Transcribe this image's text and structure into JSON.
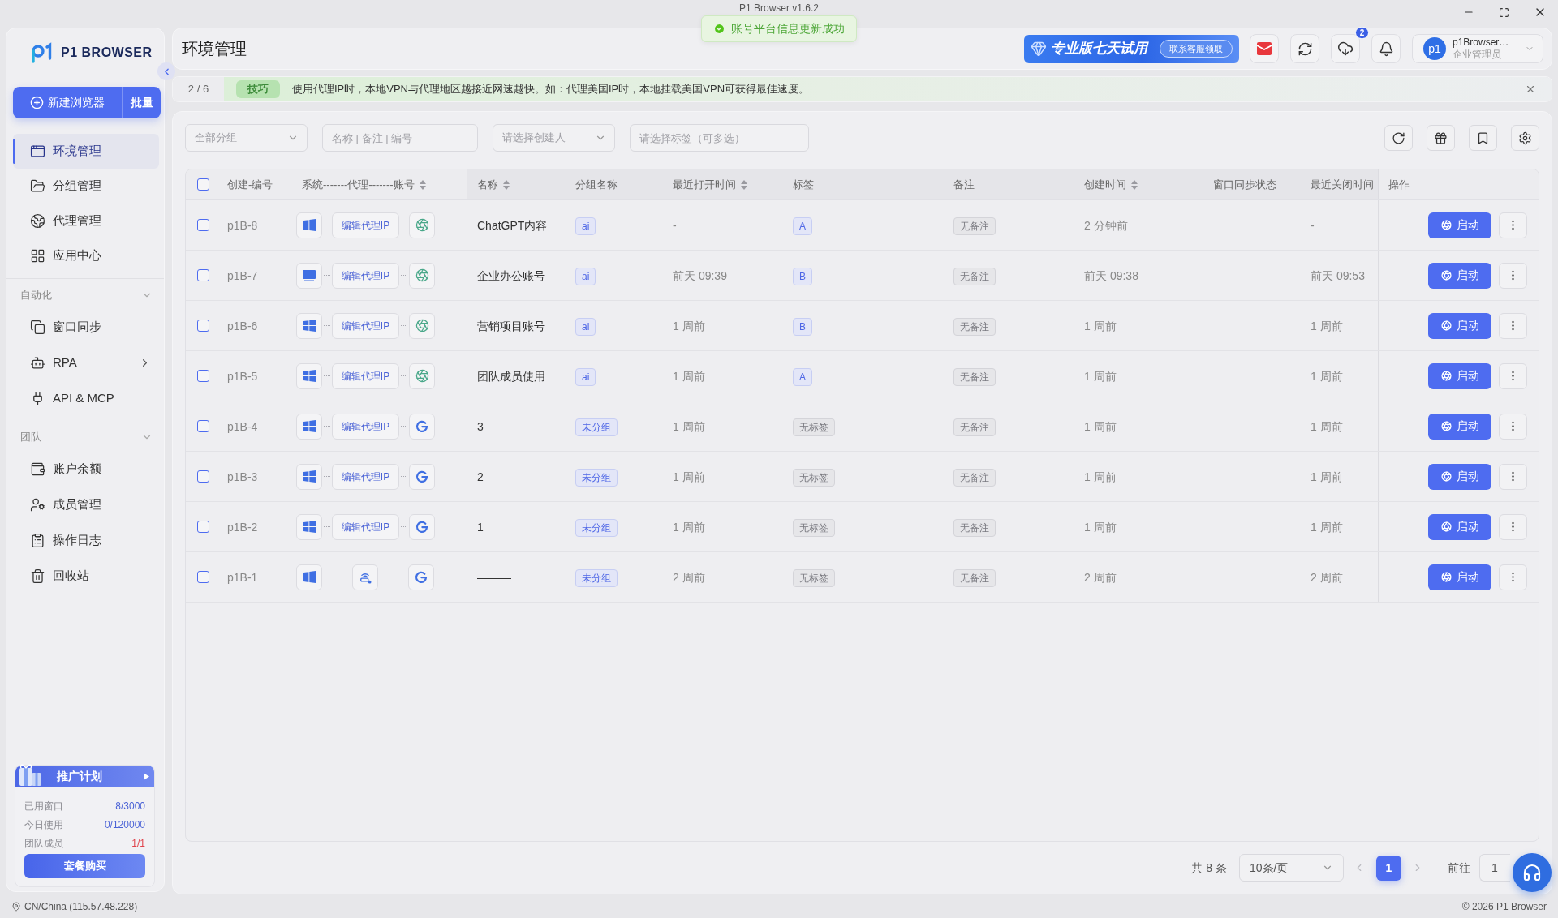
{
  "window": {
    "title": "P1 Browser v1.6.2"
  },
  "toast": {
    "text": "账号平台信息更新成功"
  },
  "sidebar": {
    "brand": "P1 BROWSER",
    "new_button": "新建浏览器",
    "batch_button": "批量",
    "nav": [
      {
        "label": "环境管理",
        "selected": true
      },
      {
        "label": "分组管理",
        "selected": false
      },
      {
        "label": "代理管理",
        "selected": false
      },
      {
        "label": "应用中心",
        "selected": false
      }
    ],
    "sections": [
      {
        "title": "自动化",
        "expanded": true,
        "items": [
          {
            "label": "窗口同步",
            "selected": false
          },
          {
            "label": "RPA",
            "selected": false,
            "expanded": false
          },
          {
            "label": "API & MCP",
            "selected": false
          }
        ]
      },
      {
        "title": "团队",
        "expanded": true,
        "items": [
          {
            "label": "账户余额",
            "selected": false
          },
          {
            "label": "成员管理",
            "selected": false
          },
          {
            "label": "操作日志",
            "selected": false
          },
          {
            "label": "回收站",
            "selected": false
          }
        ]
      }
    ],
    "promo": {
      "title": "推广计划",
      "stats": [
        {
          "label": "已用窗口",
          "value": "8/3000",
          "color": "#4a62d6"
        },
        {
          "label": "今日使用",
          "value": "0/120000",
          "color": "#4a62d6"
        },
        {
          "label": "团队成员",
          "value": "1/1",
          "color": "#e0434b"
        }
      ],
      "button": "套餐购买"
    }
  },
  "header": {
    "title": "环境管理",
    "trial": {
      "title": "专业版七天试用",
      "action": "联系客服领取"
    },
    "download_badge": "2",
    "user": {
      "avatar": "p1",
      "name": "p1Browser…",
      "role": "企业管理员"
    }
  },
  "tip": {
    "counter": "2 / 6",
    "badge": "技巧",
    "text": "使用代理IP时，本地VPN与代理地区越接近网速越快。如：代理美国IP时，本地挂载美国VPN可获得最佳速度。"
  },
  "filters": [
    {
      "kind": "select",
      "placeholder": "全部分组"
    },
    {
      "kind": "input",
      "placeholder": "名称 | 备注 | 编号"
    },
    {
      "kind": "select",
      "placeholder": "请选择创建人"
    },
    {
      "kind": "input",
      "placeholder": "请选择标签（可多选）"
    }
  ],
  "table": {
    "select_all": {
      "checked": false
    },
    "columns": [
      {
        "label": "创建-编号",
        "sortable": false
      },
      {
        "label": "系统-------代理-------账号",
        "sortable": true
      },
      {
        "label": "名称",
        "sortable": true
      },
      {
        "label": "分组名称",
        "sortable": false
      },
      {
        "label": "最近打开时间",
        "sortable": true
      },
      {
        "label": "标签",
        "sortable": false
      },
      {
        "label": "备注",
        "sortable": false
      },
      {
        "label": "创建时间",
        "sortable": true
      },
      {
        "label": "窗口同步状态",
        "sortable": false
      },
      {
        "label": "最近关闭时间",
        "sortable": false
      },
      {
        "label": "操作",
        "sortable": false
      }
    ],
    "rows": [
      {
        "checked": false,
        "code": "p1B-8",
        "system": {
          "kind": "windows"
        },
        "proxy": {
          "kind": "button",
          "label": "编辑代理IP"
        },
        "account": {
          "kind": "openai"
        },
        "name": "ChatGPT内容",
        "group": "ai",
        "last_open": "-",
        "tag": {
          "kind": "tag",
          "label": "A"
        },
        "note": "无备注",
        "created": "2 分钟前",
        "closed": "-",
        "action": "启动"
      },
      {
        "checked": false,
        "code": "p1B-7",
        "system": {
          "kind": "monitor"
        },
        "proxy": {
          "kind": "button",
          "label": "编辑代理IP"
        },
        "account": {
          "kind": "openai"
        },
        "name": "企业办公账号",
        "group": "ai",
        "last_open": "前天 09:39",
        "tag": {
          "kind": "tag",
          "label": "B"
        },
        "note": "无备注",
        "created": "前天 09:38",
        "closed": "前天 09:53",
        "action": "启动"
      },
      {
        "checked": false,
        "code": "p1B-6",
        "system": {
          "kind": "windows"
        },
        "proxy": {
          "kind": "button",
          "label": "编辑代理IP"
        },
        "account": {
          "kind": "openai"
        },
        "name": "营销项目账号",
        "group": "ai",
        "last_open": "1 周前",
        "tag": {
          "kind": "tag",
          "label": "B"
        },
        "note": "无备注",
        "created": "1 周前",
        "closed": "1 周前",
        "action": "启动"
      },
      {
        "checked": false,
        "code": "p1B-5",
        "system": {
          "kind": "windows"
        },
        "proxy": {
          "kind": "button",
          "label": "编辑代理IP"
        },
        "account": {
          "kind": "openai"
        },
        "name": "团队成员使用",
        "group": "ai",
        "last_open": "1 周前",
        "tag": {
          "kind": "tag",
          "label": "A"
        },
        "note": "无备注",
        "created": "1 周前",
        "closed": "1 周前",
        "action": "启动"
      },
      {
        "checked": false,
        "code": "p1B-4",
        "system": {
          "kind": "windows"
        },
        "proxy": {
          "kind": "button",
          "label": "编辑代理IP"
        },
        "account": {
          "kind": "google"
        },
        "name": "3",
        "group": "未分组",
        "last_open": "1 周前",
        "tag": {
          "kind": "none",
          "label": "无标签"
        },
        "note": "无备注",
        "created": "1 周前",
        "closed": "1 周前",
        "action": "启动"
      },
      {
        "checked": false,
        "code": "p1B-3",
        "system": {
          "kind": "windows"
        },
        "proxy": {
          "kind": "button",
          "label": "编辑代理IP"
        },
        "account": {
          "kind": "google"
        },
        "name": "2",
        "group": "未分组",
        "last_open": "1 周前",
        "tag": {
          "kind": "none",
          "label": "无标签"
        },
        "note": "无备注",
        "created": "1 周前",
        "closed": "1 周前",
        "action": "启动"
      },
      {
        "checked": false,
        "code": "p1B-2",
        "system": {
          "kind": "windows"
        },
        "proxy": {
          "kind": "button",
          "label": "编辑代理IP"
        },
        "account": {
          "kind": "google"
        },
        "name": "1",
        "group": "未分组",
        "last_open": "1 周前",
        "tag": {
          "kind": "none",
          "label": "无标签"
        },
        "note": "无备注",
        "created": "1 周前",
        "closed": "1 周前",
        "action": "启动"
      },
      {
        "checked": false,
        "code": "p1B-1",
        "system": {
          "kind": "windows"
        },
        "proxy": {
          "kind": "icon"
        },
        "account": {
          "kind": "google"
        },
        "name": "———",
        "group": "未分组",
        "last_open": "2 周前",
        "tag": {
          "kind": "none",
          "label": "无标签"
        },
        "note": "无备注",
        "created": "2 周前",
        "closed": "2 周前",
        "action": "启动"
      }
    ]
  },
  "pagination": {
    "total": "共 8 条",
    "page_size": "10条/页",
    "prev": {
      "disabled": true
    },
    "pages": [
      {
        "label": "1",
        "selected": true
      }
    ],
    "next": {
      "disabled": true
    },
    "goto_label": "前往",
    "goto_value": "1"
  },
  "footer": {
    "location": "CN/China (115.57.48.228)",
    "copyright": "© 2026 P1 Browser"
  }
}
